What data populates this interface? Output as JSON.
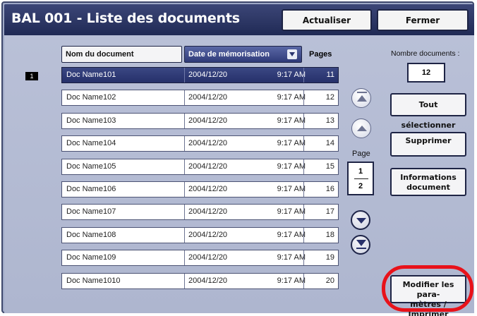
{
  "window": {
    "title": "BAL 001 - Liste des documents",
    "buttons": {
      "refresh": "Actualiser",
      "close": "Fermer"
    }
  },
  "table": {
    "headers": {
      "name": "Nom du document",
      "date": "Date de mémorisation",
      "pages": "Pages"
    },
    "selected_index": "1",
    "rows": [
      {
        "name": "Doc Name101",
        "date": "2004/12/20",
        "time": "9:17 AM",
        "pages": "11"
      },
      {
        "name": "Doc Name102",
        "date": "2004/12/20",
        "time": "9:17 AM",
        "pages": "12"
      },
      {
        "name": "Doc Name103",
        "date": "2004/12/20",
        "time": "9:17 AM",
        "pages": "13"
      },
      {
        "name": "Doc Name104",
        "date": "2004/12/20",
        "time": "9:17 AM",
        "pages": "14"
      },
      {
        "name": "Doc Name105",
        "date": "2004/12/20",
        "time": "9:17 AM",
        "pages": "15"
      },
      {
        "name": "Doc Name106",
        "date": "2004/12/20",
        "time": "9:17 AM",
        "pages": "16"
      },
      {
        "name": "Doc Name107",
        "date": "2004/12/20",
        "time": "9:17 AM",
        "pages": "17"
      },
      {
        "name": "Doc Name108",
        "date": "2004/12/20",
        "time": "9:17 AM",
        "pages": "18"
      },
      {
        "name": "Doc Name109",
        "date": "2004/12/20",
        "time": "9:17 AM",
        "pages": "19"
      },
      {
        "name": "Doc Name1010",
        "date": "2004/12/20",
        "time": "9:17 AM",
        "pages": "20"
      }
    ]
  },
  "pagination": {
    "label": "Page",
    "current": "1",
    "total": "2"
  },
  "side": {
    "count_label": "Nombre documents :",
    "count_value": "12",
    "select_all": "Tout sélectionner",
    "delete": "Supprimer",
    "info_line1": "Informations",
    "info_line2": "document",
    "modify_line1": "Modifier les para-",
    "modify_line2": "mètres / Imprimer"
  },
  "colors": {
    "highlight": "#e8121a",
    "title_bar": "#2a3463",
    "panel": "#b4bbd2"
  }
}
